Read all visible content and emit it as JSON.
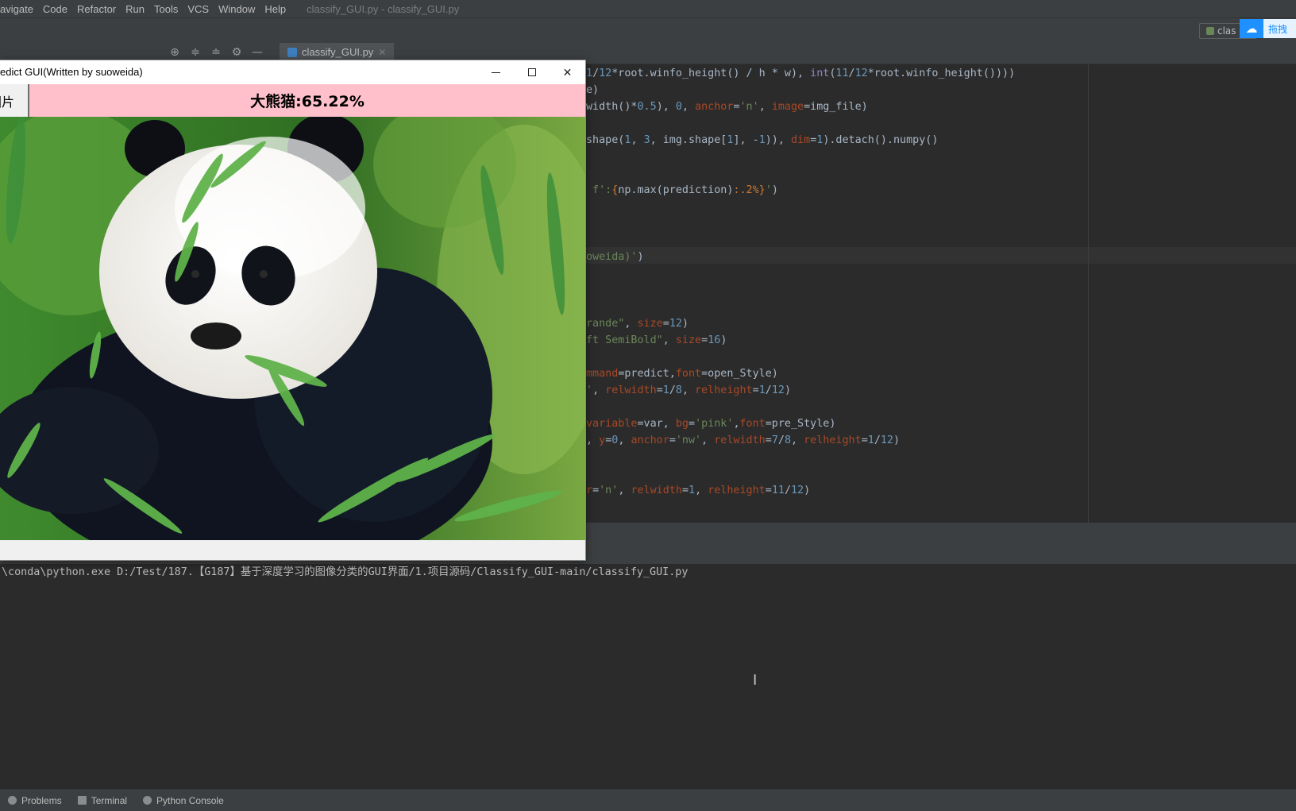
{
  "ide": {
    "menu": [
      "avigate",
      "Code",
      "Refactor",
      "Run",
      "Tools",
      "VCS",
      "Window",
      "Help"
    ],
    "window_title": "classify_GUI.py - classify_GUI.py",
    "run_config_label": "clas",
    "cloud_label": "拖拽",
    "editor_tab": "classify_GUI.py",
    "console_output": "\\conda\\python.exe D:/Test/187.【G187】基于深度学习的图像分类的GUI界面/1.项目源码/Classify_GUI-main/classify_GUI.py",
    "bottom_tabs": [
      "Problems",
      "Terminal",
      "Python Console"
    ],
    "colors": {
      "keyword": "#cc7832",
      "number": "#6897bb",
      "string": "#6a8759",
      "param": "#aa4926"
    }
  },
  "code_lines": [
    {
      "parts": [
        [
          "num",
          "1"
        ],
        [
          "",
          "/"
        ],
        [
          "num",
          "12"
        ],
        [
          "",
          "*root.winfo_height() / h * w), "
        ],
        [
          "fn",
          "int"
        ],
        [
          "",
          "("
        ],
        [
          "num",
          "11"
        ],
        [
          "",
          "/"
        ],
        [
          "num",
          "12"
        ],
        [
          "",
          "*root.winfo_height())))"
        ]
      ]
    },
    {
      "parts": [
        [
          "",
          "e)"
        ]
      ]
    },
    {
      "parts": [
        [
          "",
          "width()*"
        ],
        [
          "num",
          "0.5"
        ],
        [
          "",
          "), "
        ],
        [
          "num",
          "0"
        ],
        [
          "",
          ", "
        ],
        [
          "param",
          "anchor"
        ],
        [
          "",
          "="
        ],
        [
          "str",
          "'n'"
        ],
        [
          "",
          ", "
        ],
        [
          "param",
          "image"
        ],
        [
          "",
          "=img_file)"
        ]
      ]
    },
    {
      "parts": []
    },
    {
      "parts": [
        [
          "",
          "shape("
        ],
        [
          "num",
          "1"
        ],
        [
          "",
          ", "
        ],
        [
          "num",
          "3"
        ],
        [
          "",
          ", img.shape["
        ],
        [
          "num",
          "1"
        ],
        [
          "",
          "], -"
        ],
        [
          "num",
          "1"
        ],
        [
          "",
          ")), "
        ],
        [
          "param",
          "dim"
        ],
        [
          "",
          "="
        ],
        [
          "num",
          "1"
        ],
        [
          "",
          ").detach().numpy()"
        ]
      ]
    },
    {
      "parts": []
    },
    {
      "parts": []
    },
    {
      "parts": [
        [
          "str",
          " f':"
        ],
        [
          "fmt",
          "{"
        ],
        [
          "",
          "np.max(prediction)"
        ],
        [
          "fmt",
          ":.2%}"
        ],
        [
          "str",
          "'"
        ],
        [
          "",
          ")"
        ]
      ]
    },
    {
      "parts": []
    },
    {
      "parts": []
    },
    {
      "parts": []
    },
    {
      "parts": [
        [
          "str",
          "oweida)'"
        ],
        [
          "",
          ")"
        ]
      ]
    },
    {
      "parts": []
    },
    {
      "parts": []
    },
    {
      "parts": []
    },
    {
      "parts": [
        [
          "str",
          "rande\""
        ],
        [
          "",
          ", "
        ],
        [
          "param",
          "size"
        ],
        [
          "",
          "="
        ],
        [
          "num",
          "12"
        ],
        [
          "",
          ")"
        ]
      ]
    },
    {
      "parts": [
        [
          "str",
          "ft SemiBold\""
        ],
        [
          "",
          ", "
        ],
        [
          "param",
          "size"
        ],
        [
          "",
          "="
        ],
        [
          "num",
          "16"
        ],
        [
          "",
          ")"
        ]
      ]
    },
    {
      "parts": []
    },
    {
      "parts": [
        [
          "param",
          "mmand"
        ],
        [
          "",
          "=predict,"
        ],
        [
          "param",
          "font"
        ],
        [
          "",
          "=open_Style)"
        ]
      ]
    },
    {
      "parts": [
        [
          "str",
          "'"
        ],
        [
          "",
          ", "
        ],
        [
          "param",
          "relwidth"
        ],
        [
          "",
          "="
        ],
        [
          "num",
          "1"
        ],
        [
          "",
          "/"
        ],
        [
          "num",
          "8"
        ],
        [
          "",
          ", "
        ],
        [
          "param",
          "relheight"
        ],
        [
          "",
          "="
        ],
        [
          "num",
          "1"
        ],
        [
          "",
          "/"
        ],
        [
          "num",
          "12"
        ],
        [
          "",
          ")"
        ]
      ]
    },
    {
      "parts": []
    },
    {
      "parts": [
        [
          "param",
          "variable"
        ],
        [
          "",
          "=var, "
        ],
        [
          "param",
          "bg"
        ],
        [
          "",
          "="
        ],
        [
          "str",
          "'pink'"
        ],
        [
          "",
          ","
        ],
        [
          "param",
          "font"
        ],
        [
          "",
          "=pre_Style)"
        ]
      ]
    },
    {
      "parts": [
        [
          "",
          ", "
        ],
        [
          "param",
          "y"
        ],
        [
          "",
          "="
        ],
        [
          "num",
          "0"
        ],
        [
          "",
          ", "
        ],
        [
          "param",
          "anchor"
        ],
        [
          "",
          "="
        ],
        [
          "str",
          "'nw'"
        ],
        [
          "",
          ", "
        ],
        [
          "param",
          "relwidth"
        ],
        [
          "",
          "="
        ],
        [
          "num",
          "7"
        ],
        [
          "",
          "/"
        ],
        [
          "num",
          "8"
        ],
        [
          "",
          ", "
        ],
        [
          "param",
          "relheight"
        ],
        [
          "",
          "="
        ],
        [
          "num",
          "1"
        ],
        [
          "",
          "/"
        ],
        [
          "num",
          "12"
        ],
        [
          "",
          ")"
        ]
      ]
    },
    {
      "parts": []
    },
    {
      "parts": []
    },
    {
      "parts": [
        [
          "param",
          "r"
        ],
        [
          "",
          "="
        ],
        [
          "str",
          "'n'"
        ],
        [
          "",
          ", "
        ],
        [
          "param",
          "relwidth"
        ],
        [
          "",
          "="
        ],
        [
          "num",
          "1"
        ],
        [
          "",
          ", "
        ],
        [
          "param",
          "relheight"
        ],
        [
          "",
          "="
        ],
        [
          "num",
          "11"
        ],
        [
          "",
          "/"
        ],
        [
          "num",
          "12"
        ],
        [
          "",
          ")"
        ]
      ]
    }
  ],
  "tk_window": {
    "title": "edict GUI(Written by suoweida)",
    "open_button_label": "图片",
    "result_label": "大熊猫:65.22%",
    "result_bg": "#ffc0cb"
  }
}
